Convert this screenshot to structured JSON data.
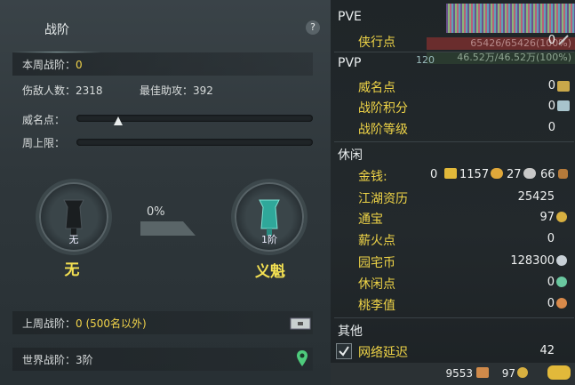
{
  "left": {
    "title": "战阶",
    "help": "?",
    "weekly_label": "本周战阶：",
    "weekly_value": "0",
    "defeated_label": "伤敌人数：",
    "defeated_value": "2318",
    "assist_label": "最佳助攻：",
    "assist_value": "392",
    "weiming_label": "威名点：",
    "week_limit_label": "周上限：",
    "progress_text": "0%",
    "current_rank_small": "无",
    "current_rank_name": "无",
    "next_rank_small": "1阶",
    "next_rank_name": "义魁",
    "last_week_label": "上周战阶：",
    "last_week_value": "0 (500名以外)",
    "world_label": "世界战阶：",
    "world_value": "3阶"
  },
  "right": {
    "hp_text": "65426/65426(100%)",
    "mp_text": "46.52万/46.52万(100%)",
    "level": "120",
    "pve_title": "PVE",
    "pve_items": [
      {
        "label": "侠行点",
        "value": "0"
      }
    ],
    "pvp_title": "PVP",
    "pvp_items": [
      {
        "label": "威名点",
        "value": "0"
      },
      {
        "label": "战阶积分",
        "value": "0"
      },
      {
        "label": "战阶等级",
        "value": "0"
      }
    ],
    "leisure_title": "休闲",
    "money_label": "金钱:",
    "money_values": [
      "0",
      "1157",
      "27",
      "66"
    ],
    "leisure_items": [
      {
        "label": "江湖资历",
        "value": "25425"
      },
      {
        "label": "通宝",
        "value": "97"
      },
      {
        "label": "薪火点",
        "value": "0"
      },
      {
        "label": "园宅币",
        "value": "128300"
      },
      {
        "label": "休闲点",
        "value": "0"
      },
      {
        "label": "桃李值",
        "value": "0"
      }
    ],
    "other_title": "其他",
    "latency_label": "网络延迟",
    "latency_value": "42",
    "footer_a": "9553",
    "footer_b": "97"
  },
  "colors": {
    "gold": "#f1d34a",
    "panel": "#2f373b",
    "accent_green": "#4ecb7c"
  }
}
